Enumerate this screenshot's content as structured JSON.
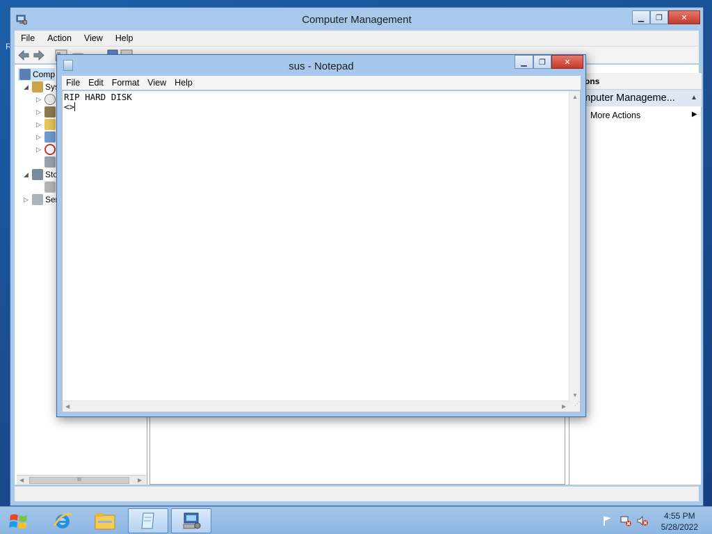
{
  "desktop": {
    "stray_char": "R"
  },
  "computer_management": {
    "title": "Computer Management",
    "menu": [
      "File",
      "Action",
      "View",
      "Help"
    ],
    "tree": [
      {
        "label": "Comp",
        "indent": 0,
        "expander": "",
        "icon": "computer-management-icon",
        "selected": true
      },
      {
        "label": "Sys",
        "indent": 1,
        "expander": "expanded",
        "icon": "system-tools-icon"
      },
      {
        "label": "",
        "indent": 2,
        "expander": "collapsed",
        "icon": "task-scheduler-icon"
      },
      {
        "label": "",
        "indent": 2,
        "expander": "collapsed",
        "icon": "event-viewer-icon"
      },
      {
        "label": "",
        "indent": 2,
        "expander": "collapsed",
        "icon": "shared-folders-icon"
      },
      {
        "label": "",
        "indent": 2,
        "expander": "collapsed",
        "icon": "local-users-icon"
      },
      {
        "label": "",
        "indent": 2,
        "expander": "collapsed",
        "icon": "performance-icon"
      },
      {
        "label": "",
        "indent": 2,
        "expander": "",
        "icon": "device-manager-icon"
      },
      {
        "label": "Sto",
        "indent": 1,
        "expander": "expanded",
        "icon": "storage-icon"
      },
      {
        "label": "",
        "indent": 2,
        "expander": "",
        "icon": "disk-management-icon"
      },
      {
        "label": "Ser",
        "indent": 1,
        "expander": "collapsed",
        "icon": "services-icon"
      }
    ],
    "tree_scroll_thumb": "III",
    "actions": {
      "header": "ons",
      "section": "mputer Manageme...",
      "more": "More Actions"
    }
  },
  "notepad": {
    "title": "sus - Notepad",
    "menu": [
      "File",
      "Edit",
      "Format",
      "View",
      "Help"
    ],
    "line1": "RIP HARD DISK",
    "line2": "<>"
  },
  "taskbar": {
    "time": "4:55 PM",
    "date": "5/28/2022",
    "apps": [
      "internet-explorer-icon",
      "file-explorer-icon",
      "notepad-icon",
      "computer-management-icon"
    ]
  },
  "colors": {
    "titlebar": "#a9c9ec",
    "close": "#c4392b",
    "taskbar": "#9cc0e8"
  }
}
